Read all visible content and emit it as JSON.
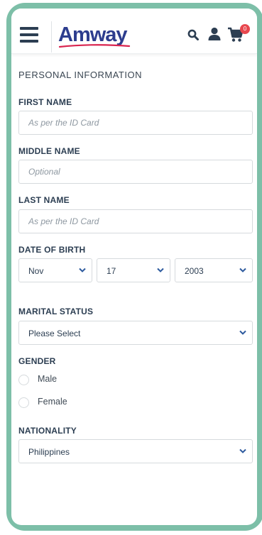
{
  "header": {
    "logo_text": "Amway",
    "cart_count": "0",
    "icons": [
      "menu-icon",
      "search-icon",
      "user-icon",
      "cart-icon"
    ]
  },
  "form": {
    "section_title": "PERSONAL INFORMATION",
    "first_name": {
      "label": "FIRST NAME",
      "placeholder": "As per the ID Card",
      "value": ""
    },
    "middle_name": {
      "label": "MIDDLE NAME",
      "placeholder": "Optional",
      "value": ""
    },
    "last_name": {
      "label": "LAST NAME",
      "placeholder": "As per the ID Card",
      "value": ""
    },
    "date_of_birth": {
      "label": "DATE OF BIRTH",
      "month": "Nov",
      "day": "17",
      "year": "2003"
    },
    "marital_status": {
      "label": "MARITAL STATUS",
      "value": "Please Select"
    },
    "gender": {
      "label": "GENDER",
      "options": [
        "Male",
        "Female"
      ]
    },
    "nationality": {
      "label": "NATIONALITY",
      "value": "Philippines"
    }
  },
  "colors": {
    "frame": "#7dbfa8",
    "brand_blue": "#2d3d8e",
    "text_dark": "#2c3e52",
    "cart_badge": "#e8474e",
    "chevron": "#2d5a9e"
  }
}
